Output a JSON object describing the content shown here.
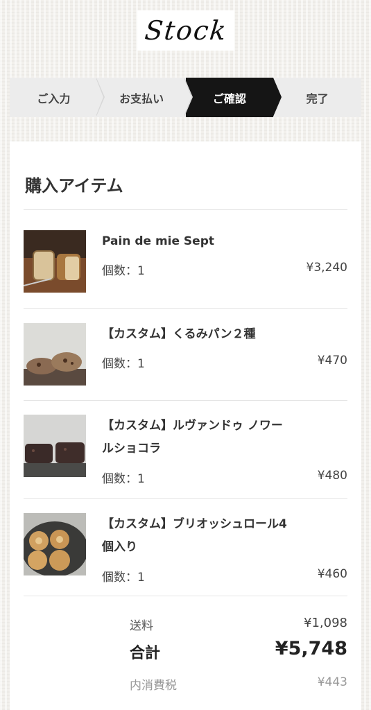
{
  "logo": "Stock",
  "steps": [
    {
      "label": "ご入力"
    },
    {
      "label": "お支払い"
    },
    {
      "label": "ご確認"
    },
    {
      "label": "完了"
    }
  ],
  "section_title": "購入アイテム",
  "items": [
    {
      "name": "Pain de mie Sept",
      "qty": "個数：1",
      "price": "¥3,240"
    },
    {
      "name": "【カスタム】くるみパン２種",
      "qty": "個数：1",
      "price": "¥470"
    },
    {
      "name_line1": "【カスタム】ルヴァンドゥ ノワー",
      "name_line2": "ルショコラ",
      "qty": "個数：1",
      "price": "¥480"
    },
    {
      "name_line1": "【カスタム】ブリオッシュロール4",
      "name_line2": "個入り",
      "qty": "個数：1",
      "price": "¥460"
    }
  ],
  "totals": {
    "shipping_label": "送料",
    "shipping_value": "¥1,098",
    "total_label": "合計",
    "total_value": "¥5,748",
    "tax_label": "内消費税",
    "tax_value": "¥443"
  }
}
